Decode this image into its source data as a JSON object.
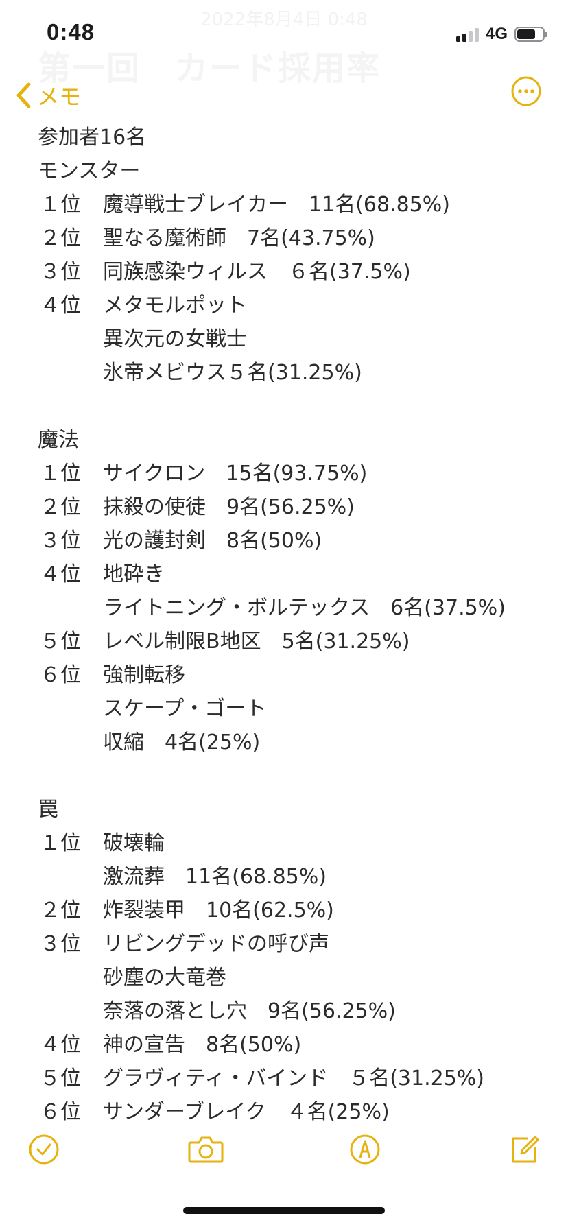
{
  "status_bar": {
    "time": "0:48",
    "network": "4G",
    "battery_level": 0.65
  },
  "faded_header": {
    "date": "2022年8月4日 0:48",
    "title": "第一回　カード採用率"
  },
  "nav": {
    "back_label": "メモ",
    "accent_color": "#e6b20e"
  },
  "note": {
    "participants": "参加者16名",
    "sections": [
      {
        "heading": "モンスター",
        "rows": [
          {
            "rank": "１位",
            "text": "魔導戦士ブレイカー　11名(68.85%)"
          },
          {
            "rank": "２位",
            "text": "聖なる魔術師　7名(43.75%)"
          },
          {
            "rank": "３位",
            "text": "同族感染ウィルス　６名(37.5%)"
          },
          {
            "rank": "４位",
            "text": "メタモルポット"
          },
          {
            "rank": "",
            "text": "異次元の女戦士"
          },
          {
            "rank": "",
            "text": "氷帝メビウス５名(31.25%)"
          }
        ]
      },
      {
        "heading": "魔法",
        "rows": [
          {
            "rank": "１位",
            "text": "サイクロン　15名(93.75%)"
          },
          {
            "rank": "２位",
            "text": "抹殺の使徒　9名(56.25%)"
          },
          {
            "rank": "３位",
            "text": "光の護封剣　8名(50%)"
          },
          {
            "rank": "４位",
            "text": "地砕き"
          },
          {
            "rank": "",
            "text": "ライトニング・ボルテックス　6名(37.5%)"
          },
          {
            "rank": "５位",
            "text": "レベル制限B地区　5名(31.25%)"
          },
          {
            "rank": "６位",
            "text": "強制転移"
          },
          {
            "rank": "",
            "text": "スケープ・ゴート"
          },
          {
            "rank": "",
            "text": "収縮　4名(25%)"
          }
        ]
      },
      {
        "heading": "罠",
        "rows": [
          {
            "rank": "１位",
            "text": "破壊輪"
          },
          {
            "rank": "",
            "text": "激流葬　11名(68.85%)"
          },
          {
            "rank": "２位",
            "text": "炸裂装甲　10名(62.5%)"
          },
          {
            "rank": "３位",
            "text": "リビングデッドの呼び声"
          },
          {
            "rank": "",
            "text": "砂塵の大竜巻"
          },
          {
            "rank": "",
            "text": "奈落の落とし穴　9名(56.25%)"
          },
          {
            "rank": "４位",
            "text": "神の宣告　8名(50%)"
          },
          {
            "rank": "５位",
            "text": "グラヴィティ・バインド　５名(31.25%)"
          },
          {
            "rank": "６位",
            "text": "サンダーブレイク　４名(25%)"
          }
        ]
      }
    ]
  },
  "toolbar": {
    "icons": [
      "checklist-icon",
      "camera-icon",
      "markup-icon",
      "compose-icon"
    ]
  }
}
